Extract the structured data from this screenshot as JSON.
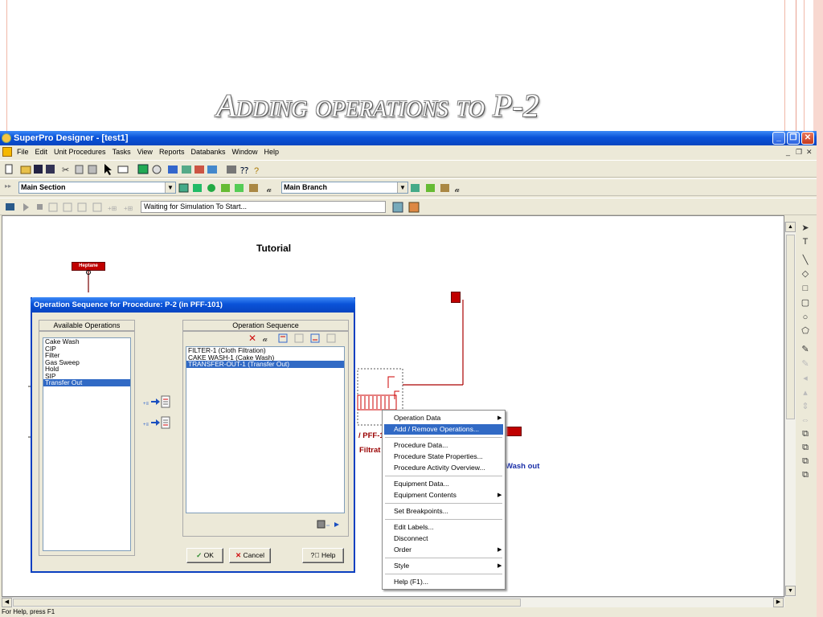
{
  "slide": {
    "title": "Adding operations to P-2"
  },
  "app": {
    "title": "SuperPro Designer - [test1]",
    "menu": [
      "File",
      "Edit",
      "Unit Procedures",
      "Tasks",
      "View",
      "Reports",
      "Databanks",
      "Window",
      "Help"
    ],
    "section_combo": "Main Section",
    "branch_combo": "Main Branch",
    "sim_status": "Waiting for Simulation To Start...",
    "status_bar": "For Help, press F1",
    "accent_color": "#0a52d8"
  },
  "canvas": {
    "flowsheet_title": "Tutorial",
    "stream_label": "Heptane",
    "procedure_label_1": "/ PFF-1",
    "procedure_label_2": "Filtrat",
    "wash_label": "Wash out",
    "stream_red_color": "#c00000",
    "wash_color": "#1a2fa8"
  },
  "dialog": {
    "title": "Operation Sequence for Procedure: P-2 (in PFF-101)",
    "available_header": "Available Operations",
    "available": [
      "Cake Wash",
      "CIP",
      "Filter",
      "Gas Sweep",
      "Hold",
      "SIP",
      "Transfer Out"
    ],
    "available_selected": "Transfer Out",
    "sequence_header": "Operation Sequence",
    "sequence": [
      "FILTER-1 (Cloth Filtration)",
      "CAKE WASH-1 (Cake Wash)",
      "TRANSFER-OUT-1 (Transfer Out)"
    ],
    "sequence_selected": "TRANSFER-OUT-1 (Transfer Out)",
    "ok_label": "OK",
    "cancel_label": "Cancel",
    "help_label": "Help"
  },
  "context_menu": {
    "items": [
      {
        "label": "Operation Data",
        "submenu": true
      },
      {
        "label": "Add / Remove Operations...",
        "highlighted": true
      },
      {
        "label": "Procedure Data..."
      },
      {
        "label": "Procedure State Properties..."
      },
      {
        "label": "Procedure Activity Overview..."
      },
      {
        "label": "Equipment Data..."
      },
      {
        "label": "Equipment Contents",
        "submenu": true
      },
      {
        "label": "Set Breakpoints..."
      },
      {
        "label": "Edit Labels..."
      },
      {
        "label": "Disconnect"
      },
      {
        "label": "Order",
        "submenu": true
      },
      {
        "label": "Style",
        "submenu": true
      },
      {
        "label": "Help (F1)..."
      }
    ]
  }
}
